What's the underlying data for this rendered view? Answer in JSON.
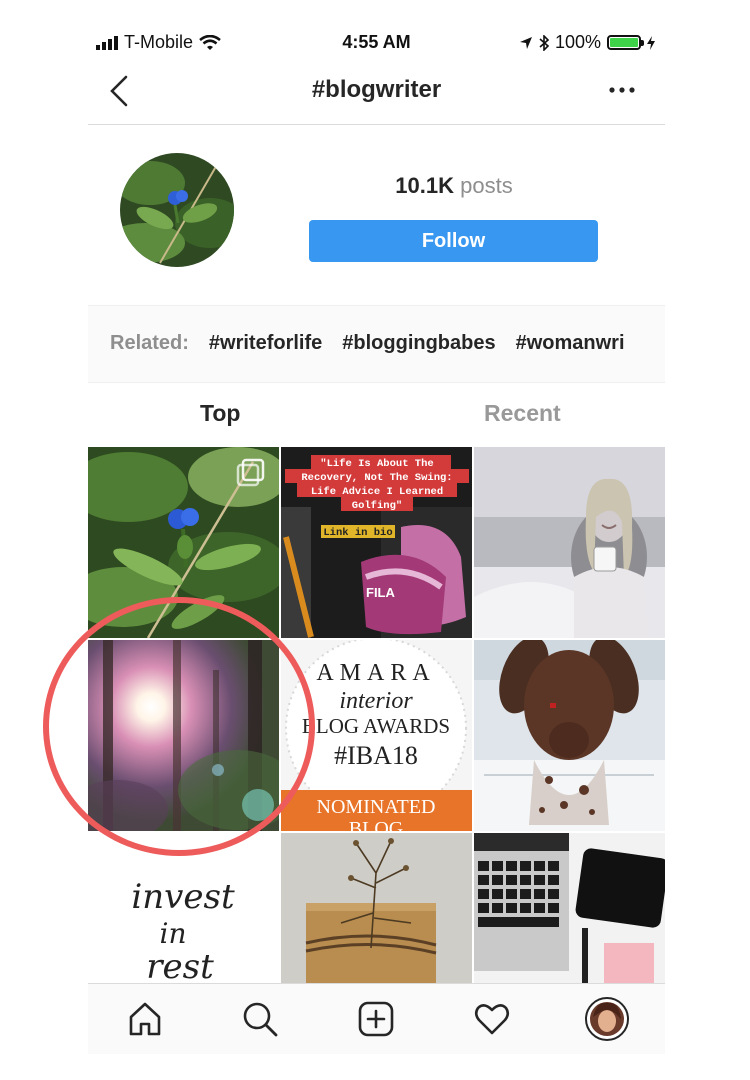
{
  "status_bar": {
    "carrier": "T-Mobile",
    "time": "4:55 AM",
    "battery": "100%",
    "battery_color": "#3fd34a"
  },
  "nav": {
    "title": "#blogwriter",
    "back_icon": "chevron-left-icon",
    "more_icon": "more-horizontal-icon"
  },
  "header": {
    "post_count": "10.1K",
    "post_unit": "posts",
    "follow_label": "Follow",
    "follow_color": "#3897f0"
  },
  "related": {
    "label": "Related:",
    "tags": [
      "#writeforlife",
      "#bloggingbabes",
      "#womanwri"
    ]
  },
  "tabs": {
    "top": "Top",
    "recent": "Recent"
  },
  "grid": {
    "post2": {
      "line1": "\"Life Is About The",
      "line2": "Recovery, Not The Swing:",
      "line3": "Life Advice I Learned",
      "line4": "Golfing\"",
      "line5": "Link in bio",
      "brand": "FILA"
    },
    "post5": {
      "line1": "AMARA",
      "line2": "interior",
      "line3": "BLOG AWARDS",
      "line4": "#IBA18",
      "line5": "NOMINATED",
      "line6": "BLOG"
    },
    "post7": {
      "line1": "invest",
      "line2": "in",
      "line3": "rest"
    }
  },
  "tab_bar": [
    "home-icon",
    "search-icon",
    "add-post-icon",
    "activity-heart-icon",
    "profile-avatar"
  ],
  "highlight_color": "#ee5b5b"
}
